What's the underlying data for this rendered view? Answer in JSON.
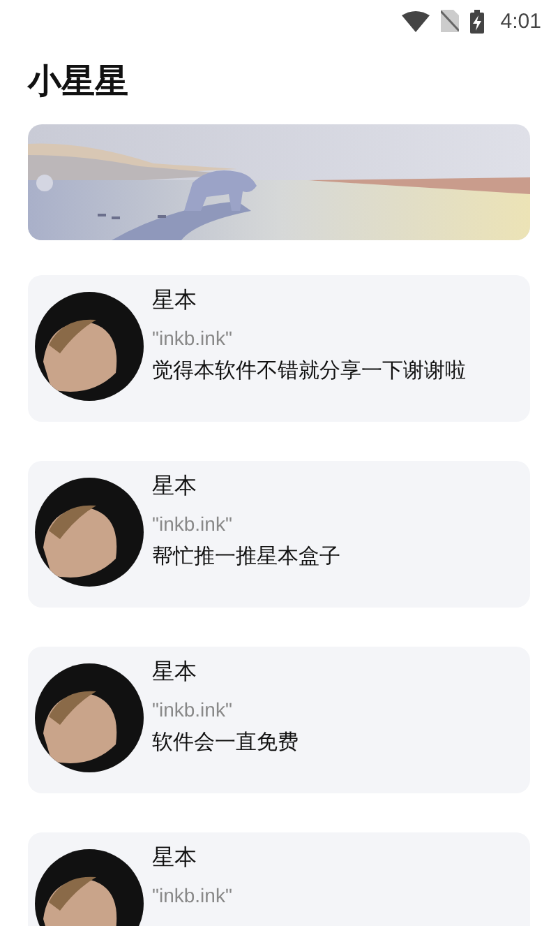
{
  "status_bar": {
    "time": "4:01"
  },
  "title": "小星星",
  "cards": [
    {
      "name": "星本",
      "source": "\"inkb.ink\"",
      "message": "觉得本软件不错就分享一下谢谢啦"
    },
    {
      "name": "星本",
      "source": "\"inkb.ink\"",
      "message": "帮忙推一推星本盒子"
    },
    {
      "name": "星本",
      "source": "\"inkb.ink\"",
      "message": "软件会一直免费"
    },
    {
      "name": "星本",
      "source": "\"inkb.ink\""
    }
  ]
}
